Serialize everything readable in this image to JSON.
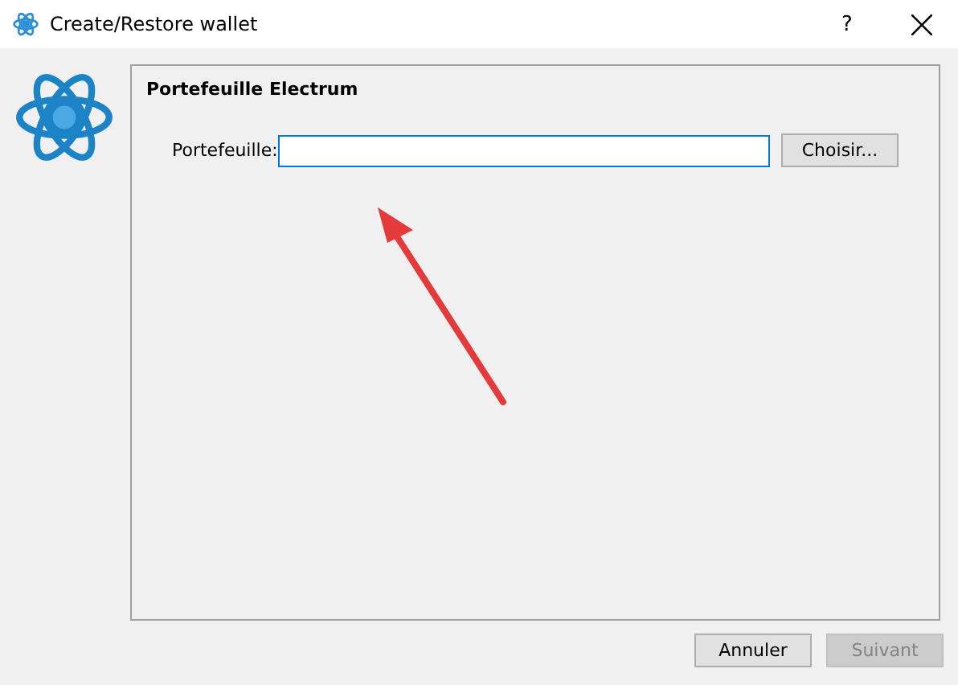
{
  "window": {
    "title": "Create/Restore wallet",
    "help": "?"
  },
  "panel": {
    "title": "Portefeuille Electrum",
    "field": {
      "label": "Portefeuille:",
      "button": "Choisir..."
    }
  },
  "buttons": [
    {
      "label": "Annuler",
      "disabled": false
    },
    {
      "label": "Suivant",
      "disabled": true
    }
  ]
}
